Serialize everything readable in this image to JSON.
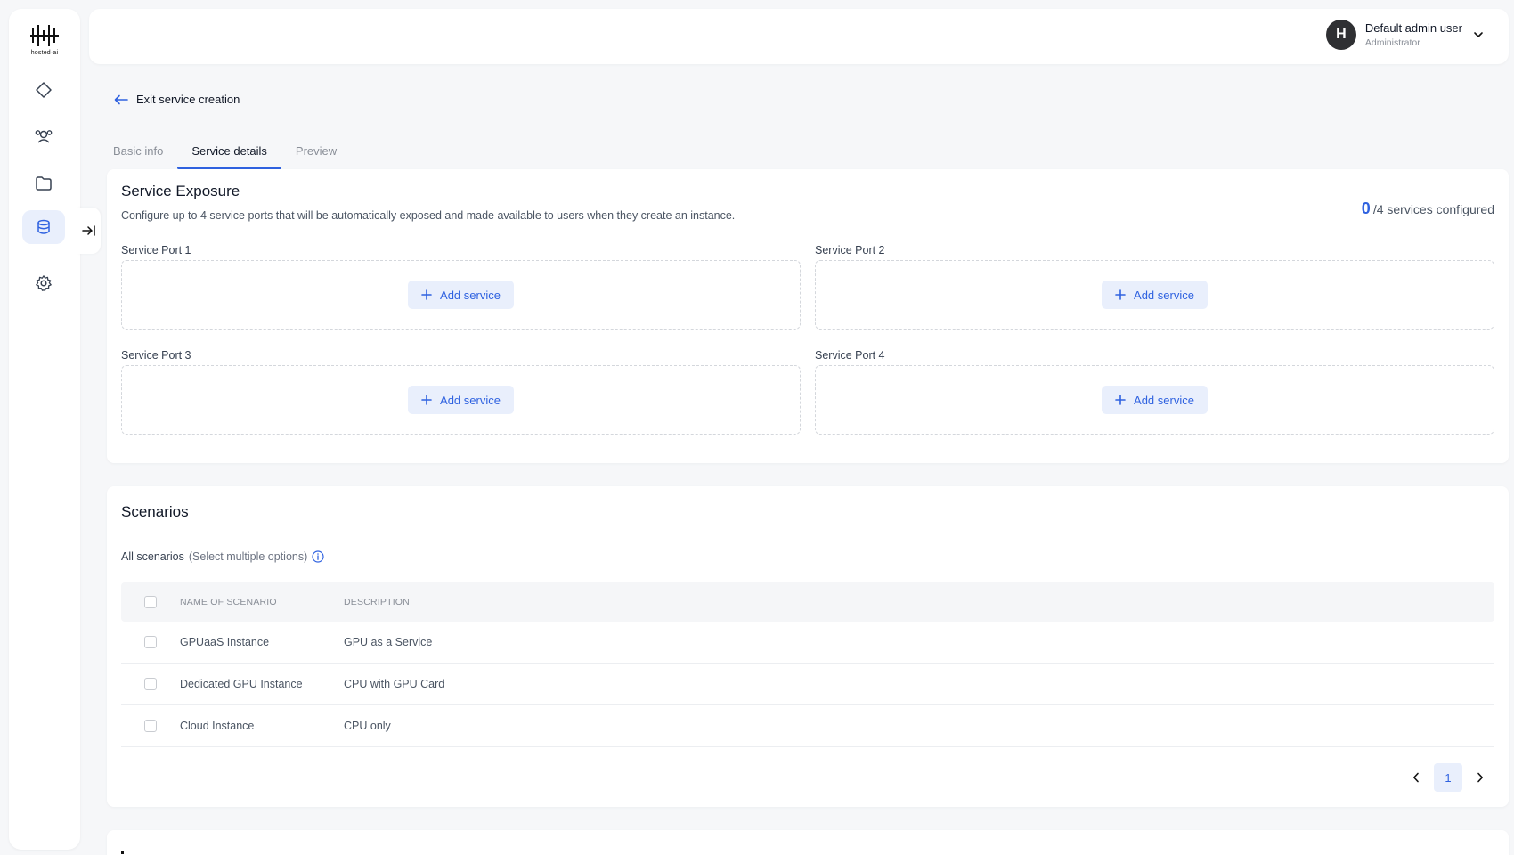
{
  "brand": {
    "logo_text": "hosted·ai"
  },
  "sidebar": {
    "items": [
      {
        "name": "dashboard",
        "icon": "diamond-icon"
      },
      {
        "name": "users",
        "icon": "users-icon"
      },
      {
        "name": "files",
        "icon": "folder-icon"
      },
      {
        "name": "services",
        "icon": "database-icon",
        "active": true
      },
      {
        "name": "settings",
        "icon": "gear-icon"
      }
    ],
    "collapse_icon": "collapse-arrow-icon"
  },
  "header": {
    "avatar_initial": "H",
    "user_name": "Default admin user",
    "user_role": "Administrator"
  },
  "nav": {
    "exit_label": "Exit service creation"
  },
  "tabs": [
    {
      "label": "Basic info",
      "active": false
    },
    {
      "label": "Service details",
      "active": true
    },
    {
      "label": "Preview",
      "active": false
    }
  ],
  "exposure": {
    "title": "Service Exposure",
    "description": "Configure up to 4 service ports that will be automatically exposed and made available to users when they create an instance.",
    "configured_count": "0",
    "configured_suffix": "/4 services configured",
    "ports": [
      {
        "label": "Service Port 1",
        "button": "Add service"
      },
      {
        "label": "Service Port 2",
        "button": "Add service"
      },
      {
        "label": "Service Port 3",
        "button": "Add service"
      },
      {
        "label": "Service Port 4",
        "button": "Add service"
      }
    ]
  },
  "scenarios": {
    "title": "Scenarios",
    "subtitle": "All scenarios",
    "hint": "(Select multiple options)",
    "columns": {
      "name": "Name of scenario",
      "description": "Description"
    },
    "rows": [
      {
        "name": "GPUaaS Instance",
        "description": "GPU as a Service"
      },
      {
        "name": "Dedicated GPU Instance",
        "description": "CPU with GPU Card"
      },
      {
        "name": "Cloud Instance",
        "description": "CPU only"
      }
    ],
    "pagination": {
      "current_page": "1"
    }
  },
  "colors": {
    "accent": "#2f62e0",
    "accent_bg": "#e9effc",
    "page_bg": "#f6f7f9"
  }
}
